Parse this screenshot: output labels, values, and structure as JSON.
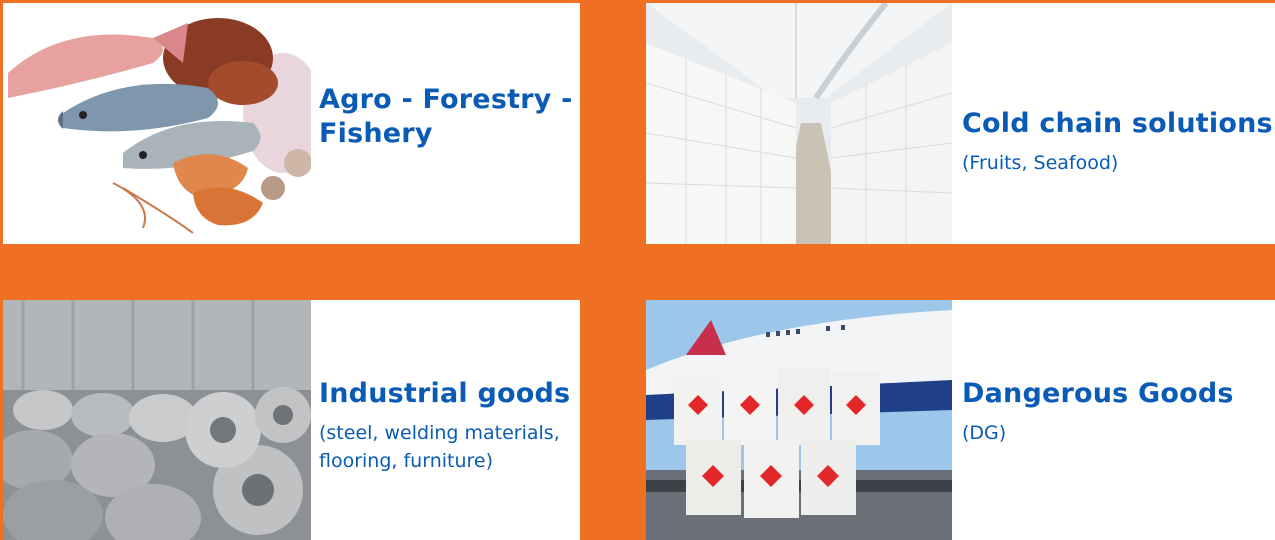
{
  "categories": [
    {
      "title": "Agro - Forestry - Fishery",
      "subtitle": "",
      "image": "seafood-photo"
    },
    {
      "title": "Cold chain solutions",
      "subtitle": "(Fruits, Seafood)",
      "image": "cold-storage-photo"
    },
    {
      "title": "Industrial goods",
      "subtitle": "(steel, welding materials, flooring, furniture)",
      "image": "steel-coils-photo"
    },
    {
      "title": "Dangerous Goods",
      "subtitle": "(DG)",
      "image": "hazmat-drums-photo"
    }
  ],
  "colors": {
    "background": "#f07023",
    "card": "#ffffff",
    "text": "#0a5bb5"
  }
}
